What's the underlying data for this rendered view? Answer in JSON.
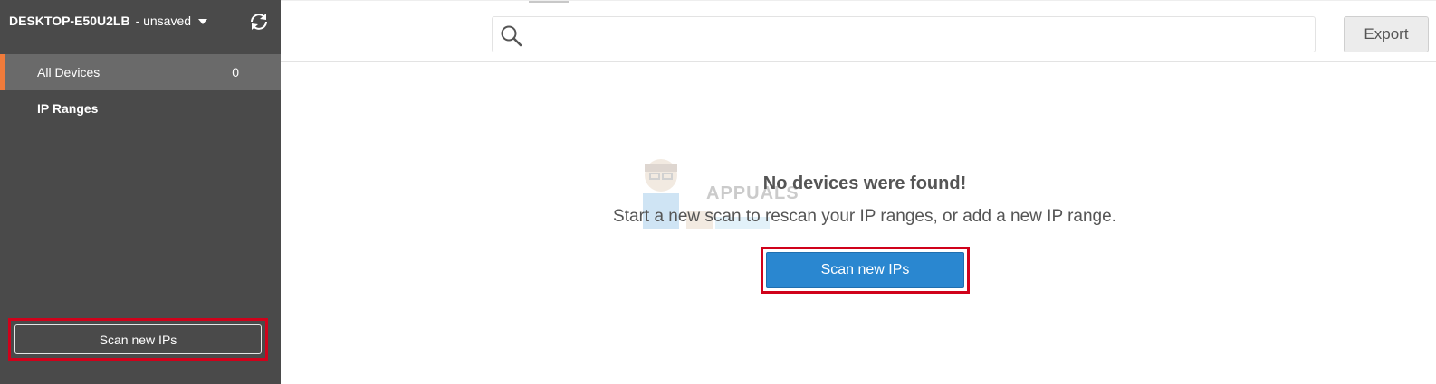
{
  "sidebar": {
    "title": "DESKTOP-E50U2LB",
    "status": "- unsaved",
    "nav": [
      {
        "label": "All Devices",
        "count": "0"
      },
      {
        "label": "IP Ranges"
      }
    ],
    "scan_button": "Scan new IPs"
  },
  "topbar": {
    "search_placeholder": "",
    "export_label": "Export"
  },
  "empty_state": {
    "title": "No devices were found!",
    "description": "Start a new scan to rescan your IP ranges, or add a new IP range.",
    "scan_button": "Scan new IPs"
  },
  "watermark": {
    "text": "APPUALS"
  },
  "colors": {
    "sidebar_bg": "#4a4a4a",
    "active_accent": "#f07b3b",
    "primary_button": "#2a87d0",
    "highlight_border": "#d0021b"
  }
}
